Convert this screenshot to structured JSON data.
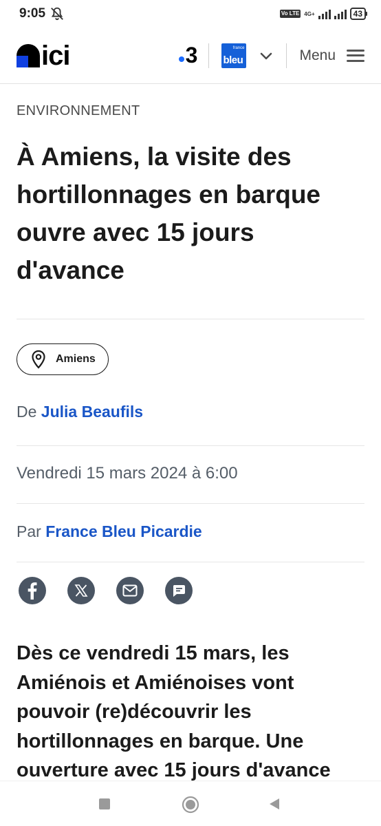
{
  "status_bar": {
    "time": "9:05",
    "network_badge": "Vo LTE",
    "network_type": "4G+",
    "battery": "43"
  },
  "header": {
    "logo_text": "ici",
    "channel_label": "3",
    "radio_label_small": "france",
    "radio_label": "bleu",
    "menu_label": "Menu"
  },
  "article": {
    "kicker": "ENVIRONNEMENT",
    "title": "À Amiens, la visite des hortillonnages en barque ouvre avec 15 jours d'avance",
    "location_tag": "Amiens",
    "author_prefix": "De",
    "author": "Julia Beaufils",
    "date": "Vendredi 15 mars 2024 à 6:00",
    "source_prefix": "Par",
    "source": "France Bleu Picardie",
    "lead": "Dès ce vendredi 15 mars, les Amiénois et Amiénoises vont pouvoir (re)découvrir les hortillonnages en barque. Une ouverture avec 15 jours d'avance"
  },
  "share_icons": [
    "facebook-icon",
    "x-icon",
    "email-icon",
    "comment-icon"
  ],
  "nav_icons": [
    "recents-icon",
    "home-icon",
    "back-icon"
  ],
  "colors": {
    "link_blue": "#1a56c7",
    "france3_dot": "#1a6bff",
    "france_bleu": "#1560d8",
    "icon_grey": "#4a5563",
    "ici_logo_blue": "#1040e0"
  }
}
